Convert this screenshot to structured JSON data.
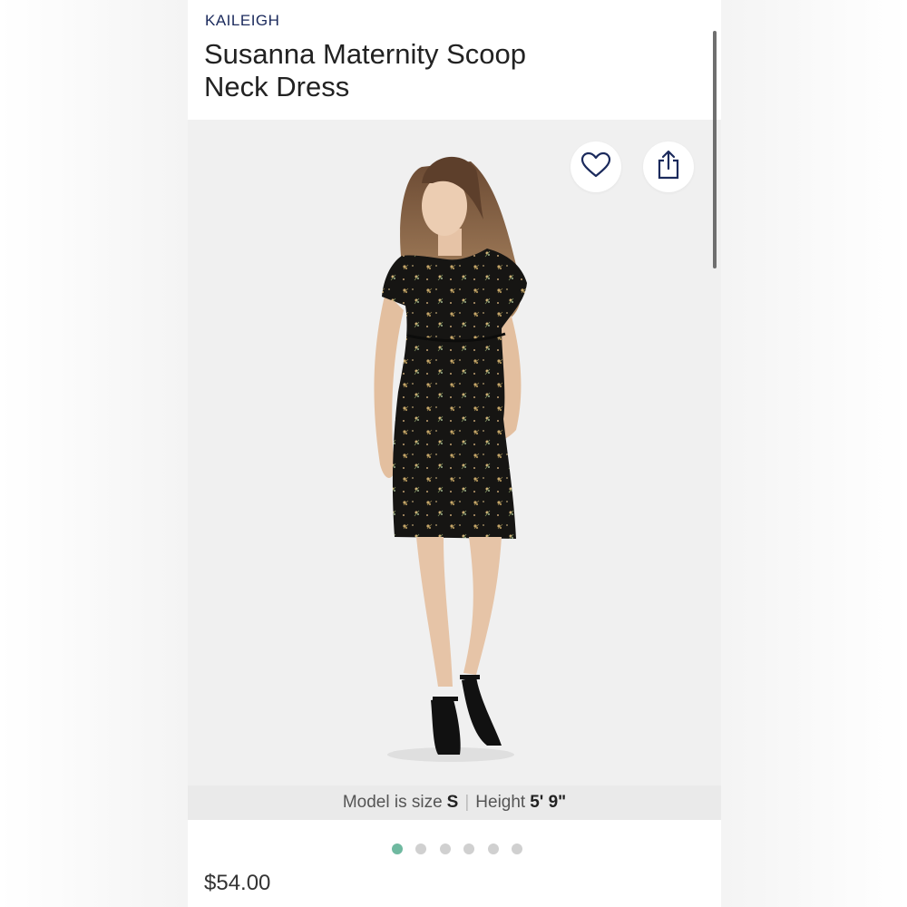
{
  "product": {
    "brand": "KAILEIGH",
    "title_line1": "Susanna Maternity Scoop",
    "title_line2": "Neck Dress",
    "price": "$54.00"
  },
  "gallery": {
    "image_count": 6,
    "active_index": 0,
    "actions": [
      {
        "name": "favorite",
        "icon": "heart-icon"
      },
      {
        "name": "share",
        "icon": "share-icon"
      }
    ]
  },
  "model_info": {
    "size_label": "Model is size",
    "size_value": "S",
    "separator": "|",
    "height_label": "Height",
    "height_value": "5' 9\""
  },
  "colors": {
    "brand": "#1b2a5c",
    "active_dot": "#6fb9a0",
    "inactive_dot": "#d0d0d0"
  }
}
